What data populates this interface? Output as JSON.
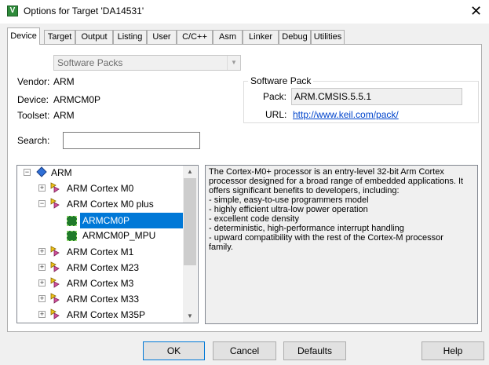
{
  "window": {
    "title": "Options for Target 'DA14531'",
    "close_glyph": "✕"
  },
  "tabs": [
    {
      "label": "Device",
      "active": true
    },
    {
      "label": "Target"
    },
    {
      "label": "Output"
    },
    {
      "label": "Listing"
    },
    {
      "label": "User"
    },
    {
      "label": "C/C++"
    },
    {
      "label": "Asm"
    },
    {
      "label": "Linker"
    },
    {
      "label": "Debug"
    },
    {
      "label": "Utilities"
    }
  ],
  "device": {
    "source_select": "Software Packs",
    "vendor_label": "Vendor:",
    "vendor": "ARM",
    "device_label": "Device:",
    "device": "ARMCM0P",
    "toolset_label": "Toolset:",
    "toolset": "ARM",
    "search_label": "Search:",
    "search_value": ""
  },
  "software_pack": {
    "title": "Software Pack",
    "pack_label": "Pack:",
    "pack": "ARM.CMSIS.5.5.1",
    "url_label": "URL:",
    "url": "http://www.keil.com/pack/"
  },
  "tree": {
    "root": "ARM",
    "items": [
      {
        "label": "ARM Cortex M0",
        "expander": "+"
      },
      {
        "label": "ARM Cortex M0 plus",
        "expander": "−"
      },
      {
        "label": "ARMCM0P",
        "selected": true
      },
      {
        "label": "ARMCM0P_MPU"
      },
      {
        "label": "ARM Cortex M1",
        "expander": "+"
      },
      {
        "label": "ARM Cortex M23",
        "expander": "+"
      },
      {
        "label": "ARM Cortex M3",
        "expander": "+"
      },
      {
        "label": "ARM Cortex M33",
        "expander": "+"
      },
      {
        "label": "ARM Cortex M35P",
        "expander": "+"
      }
    ],
    "root_expander": "−"
  },
  "description": "The Cortex-M0+ processor is an entry-level 32-bit Arm Cortex\nprocessor designed for a broad range of embedded applications. It\noffers significant benefits to developers, including:\n- simple, easy-to-use programmers model\n- highly efficient ultra-low power operation\n- excellent code density\n- deterministic, high-performance interrupt handling\n- upward compatibility with the rest of the Cortex-M processor family.",
  "buttons": {
    "ok": "OK",
    "cancel": "Cancel",
    "defaults": "Defaults",
    "help": "Help"
  },
  "colors": {
    "selection": "#0078d7",
    "link": "#0044cc",
    "chip": "#1f7a2a"
  },
  "icons": {
    "app": "uvision-icon",
    "close": "close-icon",
    "combo": "chevron-down-icon",
    "scroll_up": "scroll-up-arrow-icon",
    "scroll_down": "scroll-down-arrow-icon",
    "vendor": "vendor-diamond-icon",
    "family": "device-family-icon",
    "device": "chip-icon"
  }
}
